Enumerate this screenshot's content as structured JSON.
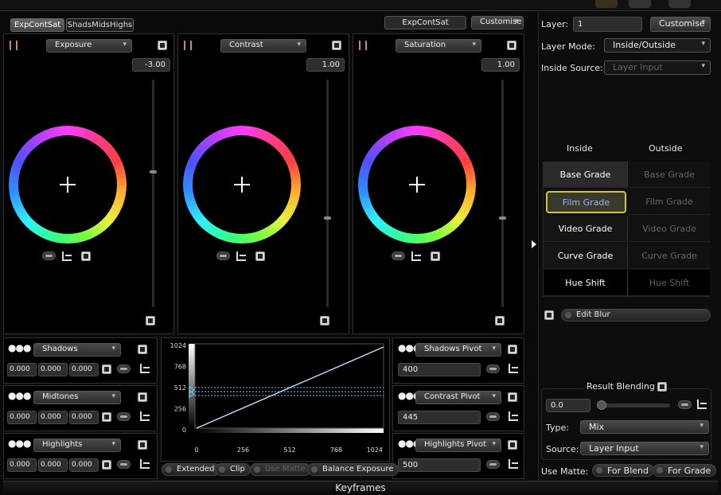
{
  "tabs": [
    "ExpContSat",
    "ShadsMidsHighs"
  ],
  "header": {
    "preset": "ExpContSat",
    "customise": "Customise"
  },
  "wheels": [
    {
      "label": "Exposure",
      "value": "-3.00",
      "slider_level": 0.6
    },
    {
      "label": "Contrast",
      "value": "1.00",
      "slider_level": 0.4
    },
    {
      "label": "Saturation",
      "value": "1.00",
      "slider_level": 0.4
    }
  ],
  "ranges": [
    {
      "label": "Shadows",
      "values": [
        "0.000",
        "0.000",
        "0.000"
      ]
    },
    {
      "label": "Midtones",
      "values": [
        "0.000",
        "0.000",
        "0.000"
      ]
    },
    {
      "label": "Highlights",
      "values": [
        "0.000",
        "0.000",
        "0.000"
      ]
    }
  ],
  "pivots": [
    {
      "label": "Shadows Pivot",
      "value": "400"
    },
    {
      "label": "Contrast Pivot",
      "value": "445"
    },
    {
      "label": "Highlights Pivot",
      "value": "500"
    }
  ],
  "curve": {
    "y_ticks": [
      "1024",
      "768",
      "512",
      "256",
      "0"
    ],
    "x_ticks": [
      "0",
      "256",
      "512",
      "768",
      "1024"
    ]
  },
  "curve_buttons": [
    "Extended",
    "Clip",
    "Use Matte",
    "Balance Exposure"
  ],
  "right": {
    "layer_label": "Layer:",
    "layer_value": "1",
    "customise": "Customise",
    "layer_mode_label": "Layer Mode:",
    "layer_mode_value": "Inside/Outside",
    "inside_source_label": "Inside Source:",
    "inside_source_value": "Layer Input",
    "inside_header": "Inside",
    "outside_header": "Outside",
    "grades": [
      {
        "inside": "Base Grade",
        "outside": "Base Grade"
      },
      {
        "inside": "Film Grade",
        "outside": "Film Grade"
      },
      {
        "inside": "Video Grade",
        "outside": "Video Grade"
      },
      {
        "inside": "Curve Grade",
        "outside": "Curve Grade"
      },
      {
        "inside": "Hue Shift",
        "outside": "Hue Shift"
      }
    ],
    "edit_blur": "Edit Blur",
    "result_blending": "Result Blending",
    "blend_value": "0.0",
    "type_label": "Type:",
    "type_value": "Mix",
    "source_label": "Source:",
    "source_value": "Layer Input",
    "use_matte_label": "Use Matte:",
    "for_blend": "For Blend",
    "for_grade": "For Grade"
  },
  "footer": {
    "keyframes": "Keyframes"
  },
  "colors": {
    "accent_highlight": "#d8c040",
    "selected_text": "#a0b4ff",
    "curve_line": "#bfe6ff"
  }
}
